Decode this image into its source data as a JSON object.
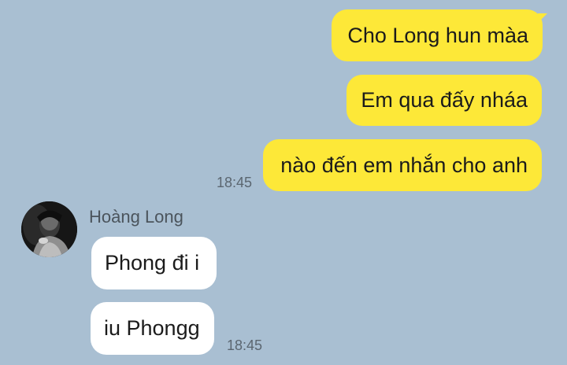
{
  "messages_out": [
    {
      "text": "Cho Long hun màa"
    },
    {
      "text": "Em qua đấy nháa"
    },
    {
      "text": "nào đến em nhắn cho anh",
      "time": "18:45"
    }
  ],
  "contact": {
    "name": "Hoàng Long",
    "avatar_icon": "person-photo-avatar"
  },
  "messages_in": [
    {
      "text": "Phong đi i"
    },
    {
      "text": "iu Phongg",
      "time": "18:45"
    }
  ],
  "colors": {
    "background": "#a9bfd2",
    "outgoing_bubble": "#fde838",
    "incoming_bubble": "#ffffff",
    "text": "#1b1b1b",
    "timestamp": "#5b6670"
  }
}
